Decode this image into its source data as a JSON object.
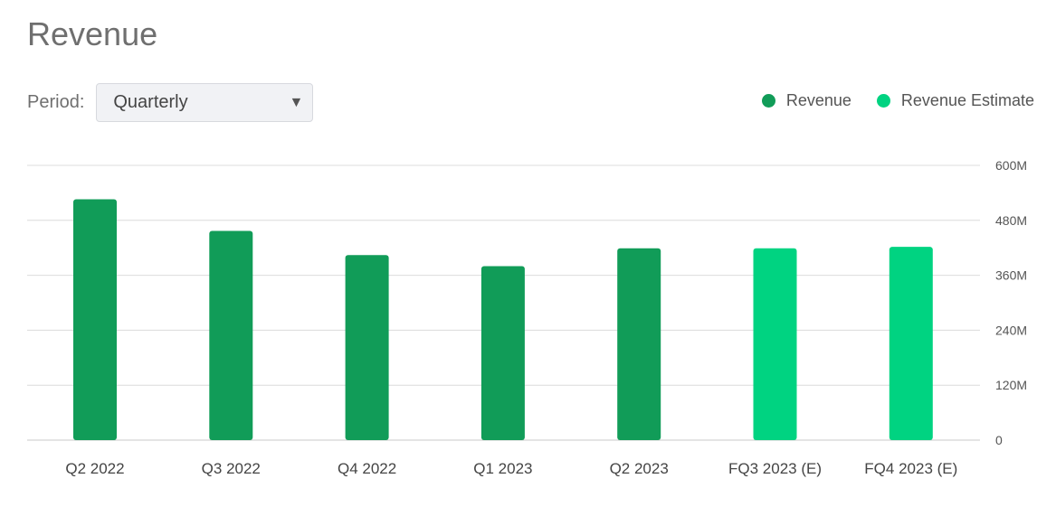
{
  "header": {
    "title": "Revenue"
  },
  "controls": {
    "period_label": "Period:",
    "period_value": "Quarterly",
    "dropdown_icon": "triangle-down-icon"
  },
  "legend": {
    "items": [
      {
        "label": "Revenue",
        "color": "#119c58"
      },
      {
        "label": "Revenue Estimate",
        "color": "#00d381"
      }
    ]
  },
  "chart_data": {
    "type": "bar",
    "categories": [
      "Q2 2022",
      "Q3 2022",
      "Q4 2022",
      "Q1 2023",
      "Q2 2023",
      "FQ3 2023 (E)",
      "FQ4 2023 (E)"
    ],
    "values": [
      526,
      457,
      404,
      380,
      419,
      419,
      422
    ],
    "series_index": [
      0,
      0,
      0,
      0,
      0,
      1,
      1
    ],
    "series": [
      {
        "name": "Revenue",
        "color": "#119c58"
      },
      {
        "name": "Revenue Estimate",
        "color": "#00d381"
      }
    ],
    "ylim": [
      0,
      600
    ],
    "y_ticks": [
      0,
      120,
      240,
      360,
      480,
      600
    ],
    "y_tick_labels": [
      "0",
      "120M",
      "240M",
      "360M",
      "480M",
      "600M"
    ],
    "y_axis_side": "right",
    "grid": true,
    "legend_position": "top-right"
  }
}
